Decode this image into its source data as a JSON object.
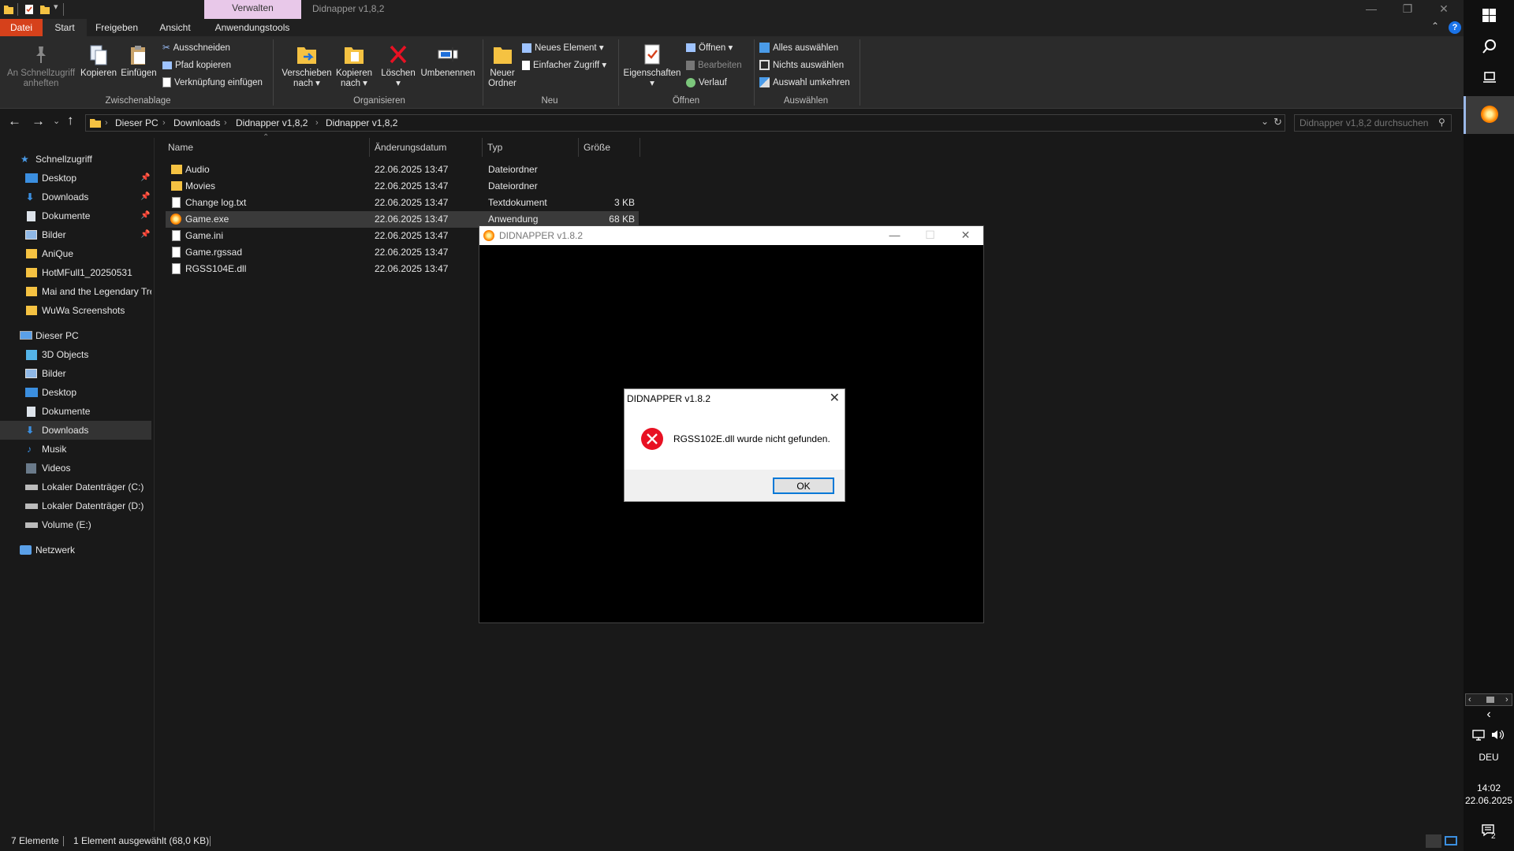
{
  "window": {
    "title": "Didnapper v1,8,2",
    "context_tab": "Verwalten"
  },
  "tabs": [
    "Datei",
    "Start",
    "Freigeben",
    "Ansicht",
    "Anwendungstools"
  ],
  "ribbon": {
    "clipboard": {
      "pin": "An Schnellzugriff anheften",
      "pin_l1": "An Schnellzugriff",
      "pin_l2": "anheften",
      "copy": "Kopieren",
      "paste": "Einfügen",
      "cut": "Ausschneiden",
      "copy_path": "Pfad kopieren",
      "paste_link": "Verknüpfung einfügen",
      "group": "Zwischenablage"
    },
    "organize": {
      "move_l1": "Verschieben",
      "move_l2": "nach",
      "copyto_l1": "Kopieren",
      "copyto_l2": "nach",
      "delete": "Löschen",
      "rename": "Umbenennen",
      "group": "Organisieren"
    },
    "new": {
      "folder_l1": "Neuer",
      "folder_l2": "Ordner",
      "new_item": "Neues Element",
      "easy_access": "Einfacher Zugriff",
      "group": "Neu"
    },
    "open": {
      "properties": "Eigenschaften",
      "open": "Öffnen",
      "edit": "Bearbeiten",
      "history": "Verlauf",
      "group": "Öffnen"
    },
    "select": {
      "all": "Alles auswählen",
      "none": "Nichts auswählen",
      "invert": "Auswahl umkehren",
      "group": "Auswählen"
    }
  },
  "address": {
    "crumbs": [
      "Dieser PC",
      "Downloads",
      "Didnapper v1,8,2",
      "Didnapper v1,8,2"
    ],
    "search_placeholder": "Didnapper v1,8,2 durchsuchen"
  },
  "nav": {
    "quick_access": "Schnellzugriff",
    "quick_items": [
      "Desktop",
      "Downloads",
      "Dokumente",
      "Bilder",
      "AniQue",
      "HotMFull1_20250531",
      "Mai and the Legendary Tre",
      "WuWa Screenshots"
    ],
    "this_pc": "Dieser PC",
    "pc_items": [
      "3D Objects",
      "Bilder",
      "Desktop",
      "Dokumente",
      "Downloads",
      "Musik",
      "Videos",
      "Lokaler Datenträger (C:)",
      "Lokaler Datenträger (D:)",
      "Volume (E:)"
    ],
    "network": "Netzwerk"
  },
  "columns": {
    "name": "Name",
    "date": "Änderungsdatum",
    "type": "Typ",
    "size": "Größe"
  },
  "files": [
    {
      "name": "Audio",
      "date": "22.06.2025 13:47",
      "type": "Dateiordner",
      "size": ""
    },
    {
      "name": "Movies",
      "date": "22.06.2025 13:47",
      "type": "Dateiordner",
      "size": ""
    },
    {
      "name": "Change log.txt",
      "date": "22.06.2025 13:47",
      "type": "Textdokument",
      "size": "3 KB"
    },
    {
      "name": "Game.exe",
      "date": "22.06.2025 13:47",
      "type": "Anwendung",
      "size": "68 KB"
    },
    {
      "name": "Game.ini",
      "date": "22.06.2025 13:47",
      "type": "",
      "size": ""
    },
    {
      "name": "Game.rgssad",
      "date": "22.06.2025 13:47",
      "type": "",
      "size": ""
    },
    {
      "name": "RGSS104E.dll",
      "date": "22.06.2025 13:47",
      "type": "",
      "size": ""
    }
  ],
  "status": {
    "count": "7 Elemente",
    "selected": "1 Element ausgewählt (68,0 KB)"
  },
  "game_window": {
    "title": "DIDNAPPER v1.8.2"
  },
  "dialog": {
    "title": "DIDNAPPER v1.8.2",
    "message": "RGSS102E.dll wurde nicht gefunden.",
    "ok": "OK"
  },
  "taskbar": {
    "lang": "DEU",
    "time": "14:02",
    "date": "22.06.2025",
    "notif_count": "2"
  },
  "colors": {
    "accent_file_tab": "#d6411b",
    "context_tab": "#e8c8e9",
    "dialog_ok_border": "#0078d7",
    "error_icon": "#e81123"
  }
}
